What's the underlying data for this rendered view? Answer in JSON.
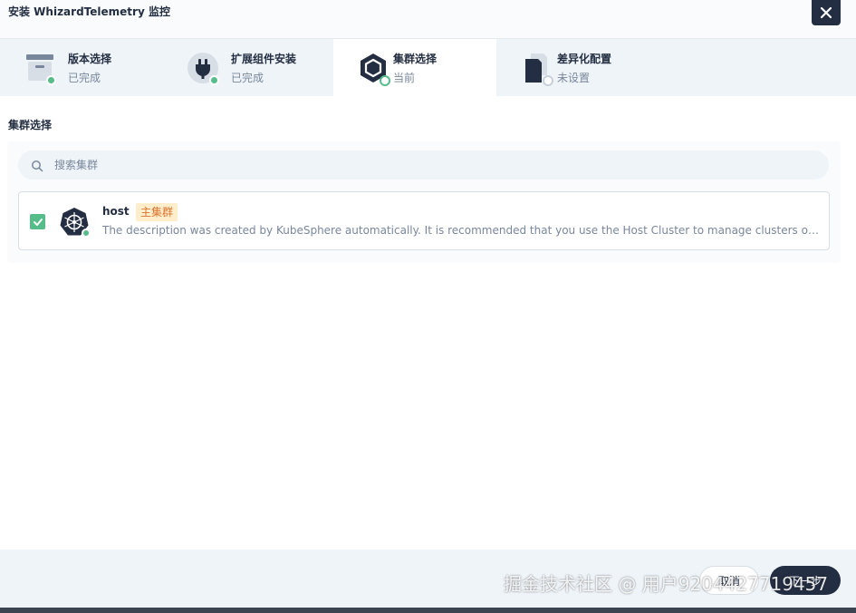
{
  "window": {
    "title": "安装 WhizardTelemetry 监控"
  },
  "steps": [
    {
      "name": "版本选择",
      "status": "已完成",
      "state": "done",
      "icon": "package-icon"
    },
    {
      "name": "扩展组件安装",
      "status": "已完成",
      "state": "done",
      "icon": "plug-icon"
    },
    {
      "name": "集群选择",
      "status": "当前",
      "state": "current",
      "icon": "cube-icon"
    },
    {
      "name": "差异化配置",
      "status": "未设置",
      "state": "pending",
      "icon": "document-icon"
    }
  ],
  "section": {
    "title": "集群选择"
  },
  "search": {
    "placeholder": "搜索集群"
  },
  "clusters": [
    {
      "name": "host",
      "tag": "主集群",
      "checked": true,
      "description": "The description was created by KubeSphere automatically. It is recommended that you use the Host Cluster to manage clusters only and deploy w..."
    }
  ],
  "footer": {
    "cancel_label": "取消",
    "next_label": "下一步"
  },
  "watermark": "掘金技术社区 @ 用户9204427719457",
  "colors": {
    "accent": "#55bc8a",
    "dark": "#242e42",
    "tag_bg": "#ffedcc",
    "tag_text": "#d8742e"
  }
}
